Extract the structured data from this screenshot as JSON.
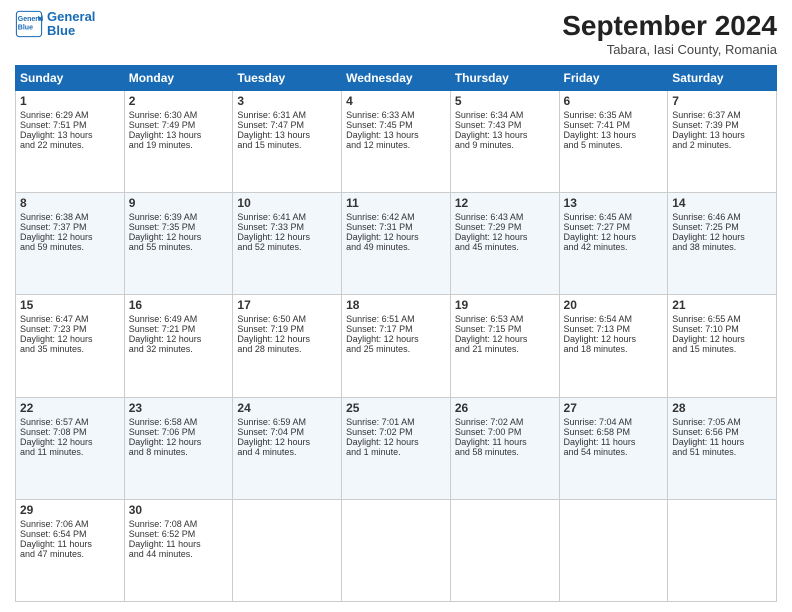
{
  "header": {
    "logo_line1": "General",
    "logo_line2": "Blue",
    "month_title": "September 2024",
    "location": "Tabara, Iasi County, Romania"
  },
  "days_of_week": [
    "Sunday",
    "Monday",
    "Tuesday",
    "Wednesday",
    "Thursday",
    "Friday",
    "Saturday"
  ],
  "weeks": [
    [
      {
        "day": "1",
        "lines": [
          "Sunrise: 6:29 AM",
          "Sunset: 7:51 PM",
          "Daylight: 13 hours",
          "and 22 minutes."
        ]
      },
      {
        "day": "2",
        "lines": [
          "Sunrise: 6:30 AM",
          "Sunset: 7:49 PM",
          "Daylight: 13 hours",
          "and 19 minutes."
        ]
      },
      {
        "day": "3",
        "lines": [
          "Sunrise: 6:31 AM",
          "Sunset: 7:47 PM",
          "Daylight: 13 hours",
          "and 15 minutes."
        ]
      },
      {
        "day": "4",
        "lines": [
          "Sunrise: 6:33 AM",
          "Sunset: 7:45 PM",
          "Daylight: 13 hours",
          "and 12 minutes."
        ]
      },
      {
        "day": "5",
        "lines": [
          "Sunrise: 6:34 AM",
          "Sunset: 7:43 PM",
          "Daylight: 13 hours",
          "and 9 minutes."
        ]
      },
      {
        "day": "6",
        "lines": [
          "Sunrise: 6:35 AM",
          "Sunset: 7:41 PM",
          "Daylight: 13 hours",
          "and 5 minutes."
        ]
      },
      {
        "day": "7",
        "lines": [
          "Sunrise: 6:37 AM",
          "Sunset: 7:39 PM",
          "Daylight: 13 hours",
          "and 2 minutes."
        ]
      }
    ],
    [
      {
        "day": "8",
        "lines": [
          "Sunrise: 6:38 AM",
          "Sunset: 7:37 PM",
          "Daylight: 12 hours",
          "and 59 minutes."
        ]
      },
      {
        "day": "9",
        "lines": [
          "Sunrise: 6:39 AM",
          "Sunset: 7:35 PM",
          "Daylight: 12 hours",
          "and 55 minutes."
        ]
      },
      {
        "day": "10",
        "lines": [
          "Sunrise: 6:41 AM",
          "Sunset: 7:33 PM",
          "Daylight: 12 hours",
          "and 52 minutes."
        ]
      },
      {
        "day": "11",
        "lines": [
          "Sunrise: 6:42 AM",
          "Sunset: 7:31 PM",
          "Daylight: 12 hours",
          "and 49 minutes."
        ]
      },
      {
        "day": "12",
        "lines": [
          "Sunrise: 6:43 AM",
          "Sunset: 7:29 PM",
          "Daylight: 12 hours",
          "and 45 minutes."
        ]
      },
      {
        "day": "13",
        "lines": [
          "Sunrise: 6:45 AM",
          "Sunset: 7:27 PM",
          "Daylight: 12 hours",
          "and 42 minutes."
        ]
      },
      {
        "day": "14",
        "lines": [
          "Sunrise: 6:46 AM",
          "Sunset: 7:25 PM",
          "Daylight: 12 hours",
          "and 38 minutes."
        ]
      }
    ],
    [
      {
        "day": "15",
        "lines": [
          "Sunrise: 6:47 AM",
          "Sunset: 7:23 PM",
          "Daylight: 12 hours",
          "and 35 minutes."
        ]
      },
      {
        "day": "16",
        "lines": [
          "Sunrise: 6:49 AM",
          "Sunset: 7:21 PM",
          "Daylight: 12 hours",
          "and 32 minutes."
        ]
      },
      {
        "day": "17",
        "lines": [
          "Sunrise: 6:50 AM",
          "Sunset: 7:19 PM",
          "Daylight: 12 hours",
          "and 28 minutes."
        ]
      },
      {
        "day": "18",
        "lines": [
          "Sunrise: 6:51 AM",
          "Sunset: 7:17 PM",
          "Daylight: 12 hours",
          "and 25 minutes."
        ]
      },
      {
        "day": "19",
        "lines": [
          "Sunrise: 6:53 AM",
          "Sunset: 7:15 PM",
          "Daylight: 12 hours",
          "and 21 minutes."
        ]
      },
      {
        "day": "20",
        "lines": [
          "Sunrise: 6:54 AM",
          "Sunset: 7:13 PM",
          "Daylight: 12 hours",
          "and 18 minutes."
        ]
      },
      {
        "day": "21",
        "lines": [
          "Sunrise: 6:55 AM",
          "Sunset: 7:10 PM",
          "Daylight: 12 hours",
          "and 15 minutes."
        ]
      }
    ],
    [
      {
        "day": "22",
        "lines": [
          "Sunrise: 6:57 AM",
          "Sunset: 7:08 PM",
          "Daylight: 12 hours",
          "and 11 minutes."
        ]
      },
      {
        "day": "23",
        "lines": [
          "Sunrise: 6:58 AM",
          "Sunset: 7:06 PM",
          "Daylight: 12 hours",
          "and 8 minutes."
        ]
      },
      {
        "day": "24",
        "lines": [
          "Sunrise: 6:59 AM",
          "Sunset: 7:04 PM",
          "Daylight: 12 hours",
          "and 4 minutes."
        ]
      },
      {
        "day": "25",
        "lines": [
          "Sunrise: 7:01 AM",
          "Sunset: 7:02 PM",
          "Daylight: 12 hours",
          "and 1 minute."
        ]
      },
      {
        "day": "26",
        "lines": [
          "Sunrise: 7:02 AM",
          "Sunset: 7:00 PM",
          "Daylight: 11 hours",
          "and 58 minutes."
        ]
      },
      {
        "day": "27",
        "lines": [
          "Sunrise: 7:04 AM",
          "Sunset: 6:58 PM",
          "Daylight: 11 hours",
          "and 54 minutes."
        ]
      },
      {
        "day": "28",
        "lines": [
          "Sunrise: 7:05 AM",
          "Sunset: 6:56 PM",
          "Daylight: 11 hours",
          "and 51 minutes."
        ]
      }
    ],
    [
      {
        "day": "29",
        "lines": [
          "Sunrise: 7:06 AM",
          "Sunset: 6:54 PM",
          "Daylight: 11 hours",
          "and 47 minutes."
        ]
      },
      {
        "day": "30",
        "lines": [
          "Sunrise: 7:08 AM",
          "Sunset: 6:52 PM",
          "Daylight: 11 hours",
          "and 44 minutes."
        ]
      },
      {
        "day": "",
        "lines": []
      },
      {
        "day": "",
        "lines": []
      },
      {
        "day": "",
        "lines": []
      },
      {
        "day": "",
        "lines": []
      },
      {
        "day": "",
        "lines": []
      }
    ]
  ]
}
